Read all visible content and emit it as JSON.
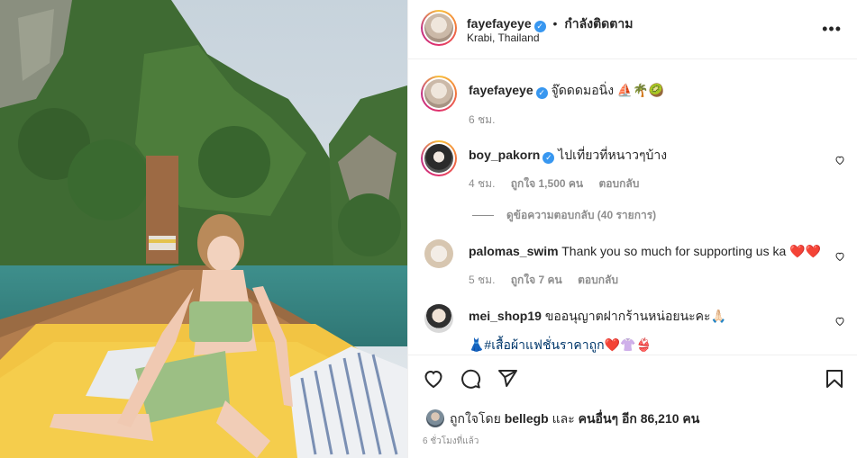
{
  "header": {
    "username": "fayefayeye",
    "separator": "•",
    "follow_state": "กำลังติดตาม",
    "location": "Krabi, Thailand",
    "more": "•••"
  },
  "caption": {
    "username": "fayefayeye",
    "text": "จู๊ดดดมอนิ่ง ⛵🌴🥝",
    "time": "6 ชม."
  },
  "comments": [
    {
      "username": "boy_pakorn",
      "verified": true,
      "text": "ไปเที่ยวที่หนาวๆบ้าง",
      "time": "4 ชม.",
      "likes": "ถูกใจ 1,500 คน",
      "reply": "ตอบกลับ",
      "view_replies": "ดูข้อความตอบกลับ (40 รายการ)"
    },
    {
      "username": "palomas_swim",
      "text": "Thank you so much for supporting us ka ❤️❤️",
      "time": "5 ชม.",
      "likes": "ถูกใจ 7 คน",
      "reply": "ตอบกลับ"
    },
    {
      "username": "mei_shop19",
      "text": "ขออนุญาตฝากร้านหน่อยนะคะ🙏🏻",
      "hashtag_line": "👗#เสื้อผ้าแฟชั่นราคาถูก❤️👚👙"
    }
  ],
  "likes": {
    "prefix": "ถูกใจโดย",
    "user": "bellegb",
    "and": "และ",
    "others": "คนอื่นๆ อีก 86,210 คน"
  },
  "timestamp": "6 ชั่วโมงที่แล้ว",
  "icons": [
    "heart-icon",
    "comment-icon",
    "share-icon",
    "bookmark-icon",
    "more-icon",
    "verified-icon"
  ],
  "colors": {
    "verified": "#3897f0",
    "secondary_text": "#8e8e8e",
    "hashtag": "#00376b"
  }
}
